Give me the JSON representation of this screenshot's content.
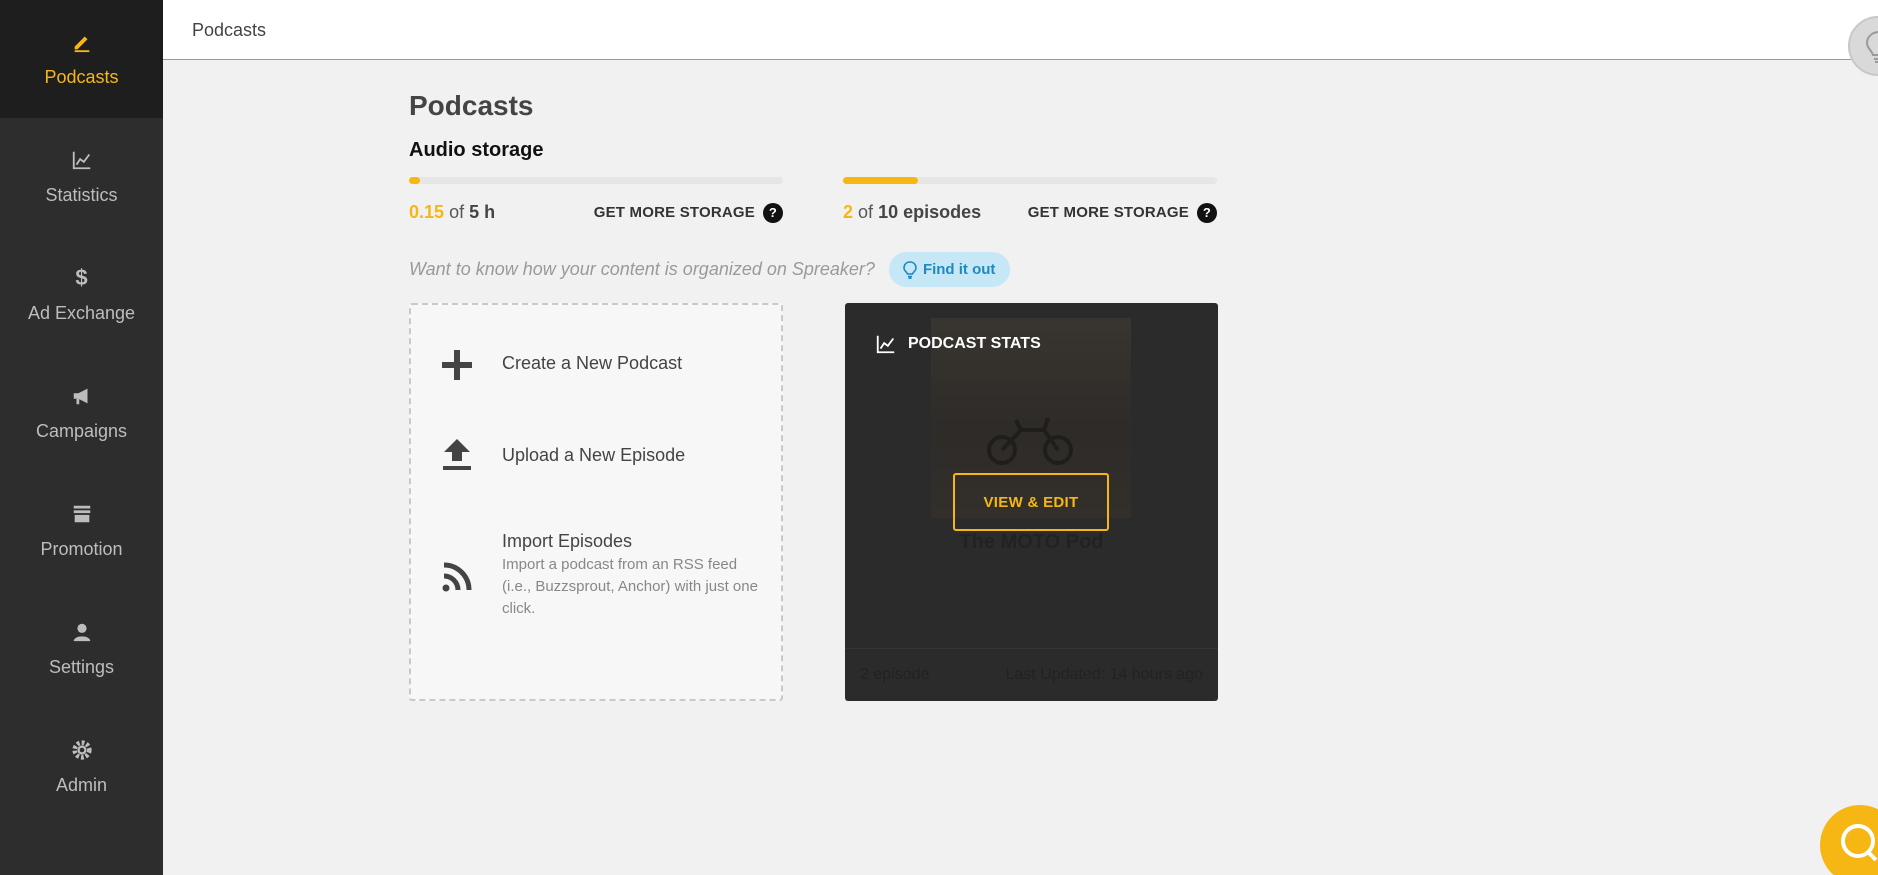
{
  "sidebar": {
    "items": [
      {
        "label": "Podcasts",
        "icon": "pencil-icon",
        "active": true
      },
      {
        "label": "Statistics",
        "icon": "chart-icon"
      },
      {
        "label": "Ad Exchange",
        "icon": "dollar-icon"
      },
      {
        "label": "Campaigns",
        "icon": "megaphone-icon"
      },
      {
        "label": "Promotion",
        "icon": "store-icon"
      },
      {
        "label": "Settings",
        "icon": "user-icon"
      },
      {
        "label": "Admin",
        "icon": "gear-icon"
      }
    ]
  },
  "topbar": {
    "breadcrumb": "Podcasts"
  },
  "main": {
    "title": "Podcasts",
    "storage_title": "Audio storage",
    "audio_meter": {
      "used": "0.15",
      "of": "of",
      "total": "5 h",
      "more": "GET MORE STORAGE",
      "help": "?",
      "fraction": 0.03
    },
    "episode_meter": {
      "used": "2",
      "of": "of",
      "total": "10 episodes",
      "more": "GET MORE STORAGE",
      "help": "?",
      "fraction": 0.2
    },
    "hint": "Want to know how your content is organized on Spreaker?",
    "find_button": "Find it out"
  },
  "create_panel": {
    "new_podcast": "Create a New Podcast",
    "upload_episode": "Upload a New Episode",
    "import_title": "Import Episodes",
    "import_desc": "Import a podcast from an RSS feed (i.e., Buzzsprout, Anchor) with just one click."
  },
  "podcast_card": {
    "stats_label": "PODCAST STATS",
    "view_edit": "VIEW & EDIT",
    "name": "The MOTO Pod",
    "episodes": "2 episode",
    "updated": "Last Updated: 14 hours ago"
  },
  "colors": {
    "accent": "#f6b715",
    "sidebar_bg": "#2d2d2d",
    "info_bg": "#c6e7f6"
  }
}
